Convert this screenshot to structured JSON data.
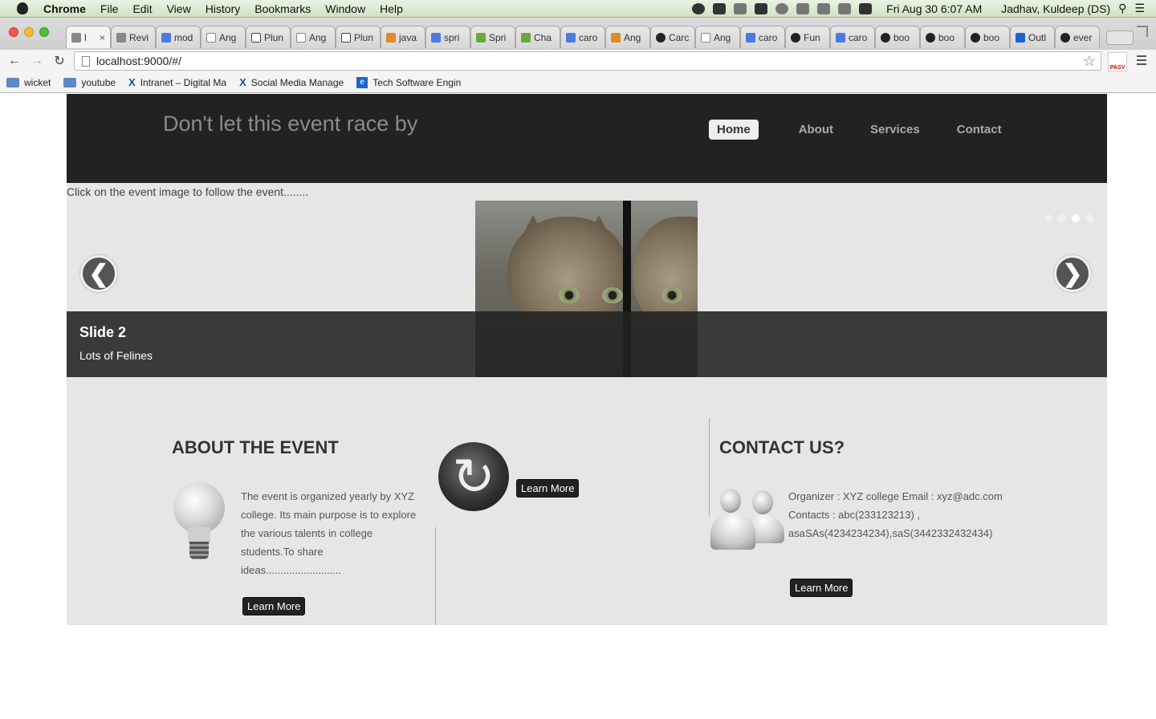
{
  "menubar": {
    "app": "Chrome",
    "items": [
      "File",
      "Edit",
      "View",
      "History",
      "Bookmarks",
      "Window",
      "Help"
    ],
    "clock": "Fri Aug 30  6:07 AM",
    "user": "Jadhav, Kuldeep (DS)"
  },
  "tabs": [
    {
      "label": "l",
      "icon": "loading-icon"
    },
    {
      "label": "Revi",
      "icon": "review-icon"
    },
    {
      "label": "mod",
      "icon": "google-icon"
    },
    {
      "label": "Ang",
      "icon": "document-icon"
    },
    {
      "label": "Plun",
      "icon": "download-icon"
    },
    {
      "label": "Ang",
      "icon": "document-icon"
    },
    {
      "label": "Plun",
      "icon": "download-icon"
    },
    {
      "label": "java",
      "icon": "stackoverflow-icon"
    },
    {
      "label": "spri",
      "icon": "google-icon"
    },
    {
      "label": "Spri",
      "icon": "spring-icon"
    },
    {
      "label": "Cha",
      "icon": "spring-icon"
    },
    {
      "label": "caro",
      "icon": "google-icon"
    },
    {
      "label": "Ang",
      "icon": "stackoverflow-icon"
    },
    {
      "label": "Carc",
      "icon": "github-icon"
    },
    {
      "label": "Ang",
      "icon": "document-icon"
    },
    {
      "label": "caro",
      "icon": "google-icon"
    },
    {
      "label": "Fun",
      "icon": "github-icon"
    },
    {
      "label": "caro",
      "icon": "google-icon"
    },
    {
      "label": "boo",
      "icon": "github-icon"
    },
    {
      "label": "boo",
      "icon": "github-icon"
    },
    {
      "label": "boo",
      "icon": "github-icon"
    },
    {
      "label": "Outl",
      "icon": "outlook-icon"
    },
    {
      "label": "ever",
      "icon": "github-icon"
    }
  ],
  "address": {
    "url": "localhost:9000/#/"
  },
  "bookmarks": [
    {
      "label": "wicket",
      "icon": "folder-icon"
    },
    {
      "label": "youtube",
      "icon": "folder-icon"
    },
    {
      "label": "Intranet – Digital Ma",
      "icon": "x-icon"
    },
    {
      "label": "Social Media Manage",
      "icon": "x-icon"
    },
    {
      "label": "Tech Software Engin",
      "icon": "e-icon"
    }
  ],
  "site": {
    "brand": "Don't let this event race by",
    "nav": [
      {
        "label": "Home",
        "active": true
      },
      {
        "label": "About",
        "active": false
      },
      {
        "label": "Services",
        "active": false
      },
      {
        "label": "Contact",
        "active": false
      }
    ],
    "instruction": "Click on the event image to follow the event........"
  },
  "carousel": {
    "slide_title": "Slide 2",
    "slide_text": "Lots of Felines",
    "prev_glyph": "❮",
    "next_glyph": "❯",
    "indicator_count": 4,
    "active_index": 2
  },
  "about": {
    "title": "ABOUT THE EVENT",
    "text": "The event is organized yearly by XYZ college. Its main purpose is to explore the various talents in college students.To share ideas..........................",
    "button": "Learn More"
  },
  "refresh": {
    "button": "Learn More"
  },
  "contact": {
    "title": "CONTACT US?",
    "text": "Organizer : XYZ college Email : xyz@adc.com Contacts : abc(233123213) , asaSAs(4234234234),saS(3442332432434)",
    "button": "Learn More"
  }
}
